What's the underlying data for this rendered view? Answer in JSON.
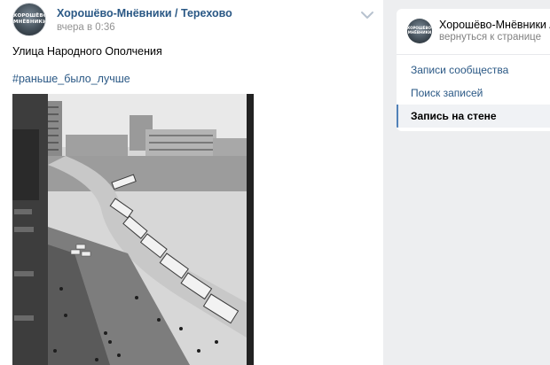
{
  "post": {
    "author": "Хорошёво-Мнёвники / Терехово",
    "avatar_text": "ХОРОШЁВО-\nМНЁВНИКИ",
    "date": "вчера в 0:36",
    "text": "Улица Народного Ополчения",
    "hashtag": "#раньше_было_лучше",
    "menu_icon": "chevron-down-icon"
  },
  "sidebar": {
    "group_name": "Хорошёво-Мнёвники / Т...",
    "back_link": "вернуться к странице",
    "avatar_text": "ХОРОШЁВО-\nМНЁВНИКИ",
    "items": [
      {
        "label": "Записи сообщества",
        "active": false
      },
      {
        "label": "Поиск записей",
        "active": false
      },
      {
        "label": "Запись на стене",
        "active": true
      }
    ]
  },
  "colors": {
    "link": "#2a5885",
    "page_bg": "#edeef0",
    "active_marker": "#5181b8"
  }
}
